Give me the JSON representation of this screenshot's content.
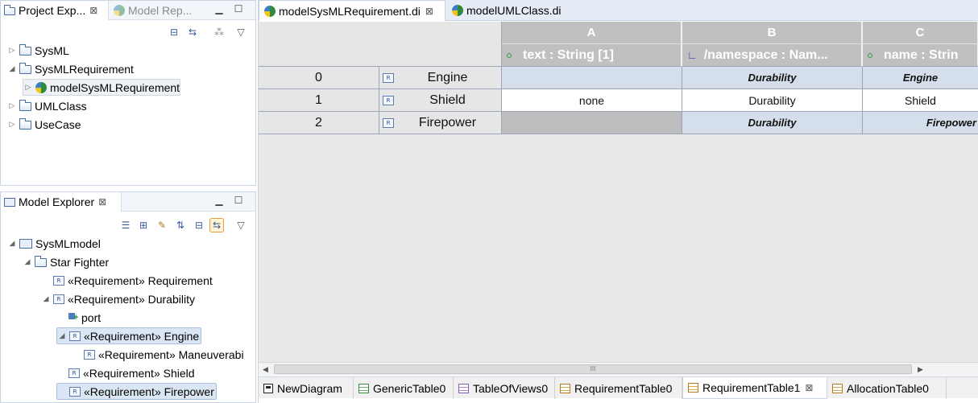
{
  "project_explorer": {
    "tab_label": "Project Exp...",
    "inactive_tab_label": "Model Rep...",
    "close_glyph": "⊠",
    "tree": [
      {
        "label": "SysML",
        "depth": 0,
        "expanded": false
      },
      {
        "label": "SysMLRequirement",
        "depth": 0,
        "expanded": true
      },
      {
        "label": "modelSysMLRequirement",
        "depth": 1,
        "expanded": false
      },
      {
        "label": "UMLClass",
        "depth": 0,
        "expanded": false
      },
      {
        "label": "UseCase",
        "depth": 0,
        "expanded": false
      }
    ]
  },
  "model_explorer": {
    "tab_label": "Model Explorer",
    "close_glyph": "⊠",
    "tree": [
      {
        "label": "SysMLmodel"
      },
      {
        "label": "Star Fighter"
      },
      {
        "label": "«Requirement» Requirement"
      },
      {
        "label": "«Requirement» Durability"
      },
      {
        "label": "port"
      },
      {
        "label": "«Requirement» Engine"
      },
      {
        "label": "«Requirement» Maneuverabi"
      },
      {
        "label": "«Requirement» Shield"
      },
      {
        "label": "«Requirement» Firepower"
      }
    ]
  },
  "editor": {
    "tabs": [
      {
        "label": "modelSysMLRequirement.di",
        "active": true
      },
      {
        "label": "modelUMLClass.di",
        "active": false
      }
    ],
    "close_glyph": "⊠",
    "table": {
      "column_letters": [
        "A",
        "B",
        "C"
      ],
      "column_headers": [
        "text : String [1]",
        "/namespace : Nam...",
        "name : Strin"
      ],
      "rows": [
        {
          "index": "0",
          "name": "Engine",
          "cells": [
            "",
            "Durability",
            "Engine"
          ],
          "style": "selected"
        },
        {
          "index": "1",
          "name": "Shield",
          "cells": [
            "none",
            "Durability",
            "Shield"
          ],
          "style": "normal"
        },
        {
          "index": "2",
          "name": "Firepower",
          "cells": [
            "",
            "Durability",
            "Firepower"
          ],
          "style": "selected"
        }
      ]
    },
    "scroll_grip": "III",
    "bottom_tabs": [
      {
        "label": "NewDiagram",
        "icon": "diagram-icon"
      },
      {
        "label": "GenericTable0",
        "icon": "table-icon"
      },
      {
        "label": "TableOfViews0",
        "icon": "table-icon"
      },
      {
        "label": "RequirementTable0",
        "icon": "table-icon"
      },
      {
        "label": "RequirementTable1",
        "icon": "table-icon",
        "active": true
      },
      {
        "label": "AllocationTable0",
        "icon": "table-icon"
      }
    ]
  },
  "colors": {
    "selection": "#dbe6f5",
    "header_grey": "#c0c0c0",
    "selected_row": "#d5dfec"
  }
}
